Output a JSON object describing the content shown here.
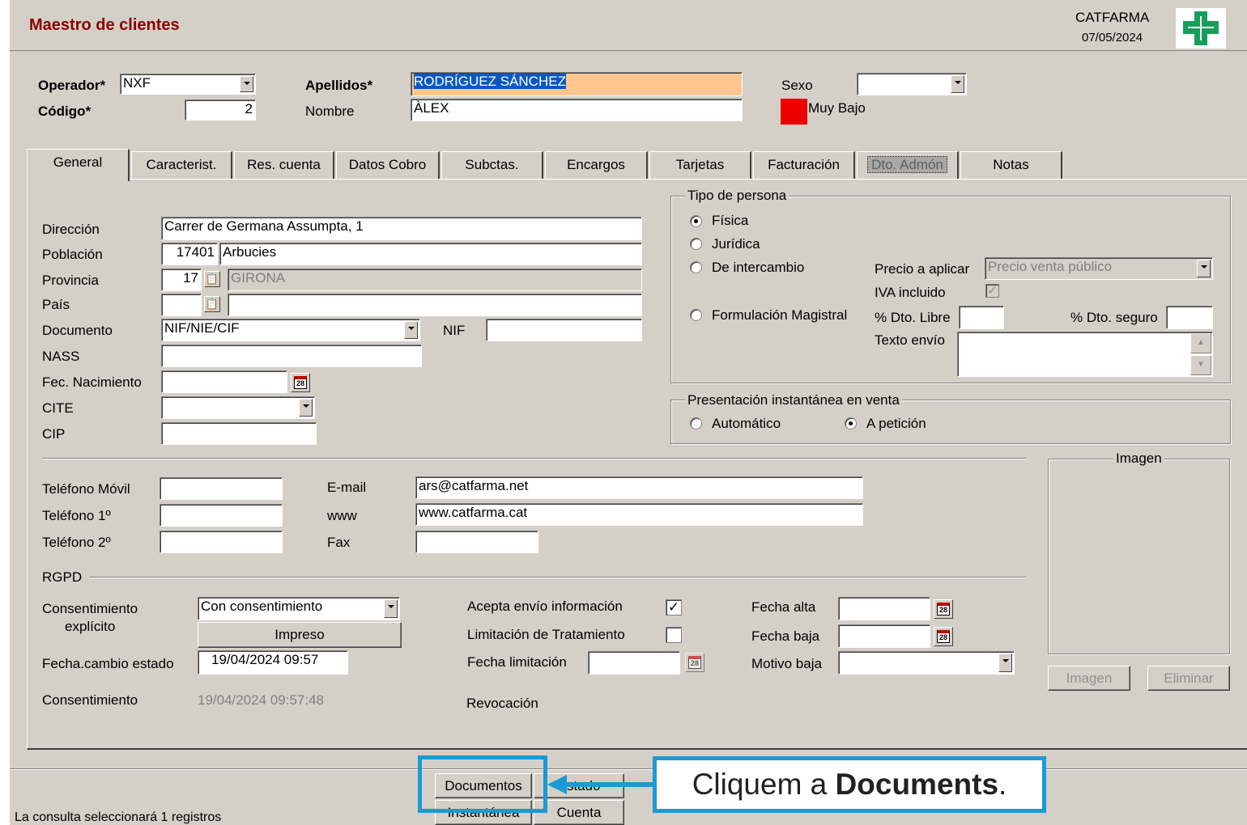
{
  "header": {
    "title": "Maestro de clientes",
    "company": "CATFARMA",
    "date": "07/05/2024"
  },
  "form": {
    "operador_label": "Operador*",
    "operador_value": "NXF",
    "codigo_label": "Código*",
    "codigo_value": "2",
    "apellidos_label": "Apellidos*",
    "apellidos_value": "RODRÍGUEZ SÁNCHEZ",
    "nombre_label": "Nombre",
    "nombre_value": "ÀLEX",
    "sexo_label": "Sexo",
    "sexo_value": "",
    "risk_label": "Muy Bajo",
    "risk_color": "#ee0000"
  },
  "tabs": [
    "General",
    "Caracterist.",
    "Res. cuenta",
    "Datos Cobro",
    "Subctas.",
    "Encargos",
    "Tarjetas",
    "Facturación",
    "Dto. Admón",
    "Notas"
  ],
  "general": {
    "direccion_label": "Dirección",
    "direccion_value": "Carrer de Germana Assumpta, 1",
    "poblacion_label": "Población",
    "poblacion_cp": "17401",
    "poblacion_value": "Arbucies",
    "provincia_label": "Provincia",
    "provincia_code": "17",
    "provincia_value": "GIRONA",
    "pais_label": "País",
    "pais_code": "",
    "pais_value": "",
    "documento_label": "Documento",
    "documento_value": "NIF/NIE/CIF",
    "nif_label": "NIF",
    "nif_value": "",
    "nass_label": "NASS",
    "fec_nac_label": "Fec. Nacimiento",
    "cite_label": "CITE",
    "cip_label": "CIP"
  },
  "tipo_persona": {
    "title": "Tipo de persona",
    "options": [
      "Física",
      "Jurídica",
      "De intercambio",
      "Formulación Magistral"
    ],
    "precio_label": "Precio a aplicar",
    "precio_value": "Precio venta público",
    "iva_label": "IVA incluido",
    "dto_libre_label": "% Dto. Libre",
    "dto_seguro_label": "% Dto. seguro",
    "texto_envio_label": "Texto envío"
  },
  "presentacion": {
    "title": "Presentación instantánea en venta",
    "automatico": "Automático",
    "a_peticion": "A petición"
  },
  "contact": {
    "movil_label": "Teléfono Móvil",
    "tel1_label": "Teléfono 1º",
    "tel2_label": "Teléfono 2º",
    "email_label": "E-mail",
    "email_value": "ars@catfarma.net",
    "www_label": "www",
    "www_value": "www.catfarma.cat",
    "fax_label": "Fax"
  },
  "imagen": {
    "title": "Imagen",
    "imagen_button": "Imagen",
    "eliminar_button": "Eliminar"
  },
  "rgpd": {
    "title": "RGPD",
    "consentimiento_label_1": "Consentimiento",
    "consentimiento_label_2": "explícito",
    "consentimiento_value": "Con consentimiento",
    "impreso_button": "Impreso",
    "fecha_cambio_label": "Fecha.cambio estado",
    "fecha_cambio_value": "19/04/2024 09:57",
    "consentimiento2_label": "Consentimiento",
    "consentimiento2_value": "19/04/2024 09:57:48",
    "acepta_label": "Acepta envío información",
    "acepta_checked": "✓",
    "limitacion_label": "Limitación de Tratamiento",
    "fecha_limitacion_label": "Fecha limitación",
    "revocacion_label": "Revocación",
    "fecha_alta_label": "Fecha alta",
    "fecha_baja_label": "Fecha baja",
    "motivo_baja_label": "Motivo baja"
  },
  "bottom": {
    "documentos_button": "Documentos",
    "estado_button": "Estado",
    "instantanea_button": "Instantánea",
    "cuenta_button": "Cuenta",
    "status_text": "La consulta seleccionará 1  registros"
  },
  "callout": {
    "prefix": "Cliquem a ",
    "bold": "Documents",
    "suffix": ".",
    "color": "#1a9ad6"
  }
}
